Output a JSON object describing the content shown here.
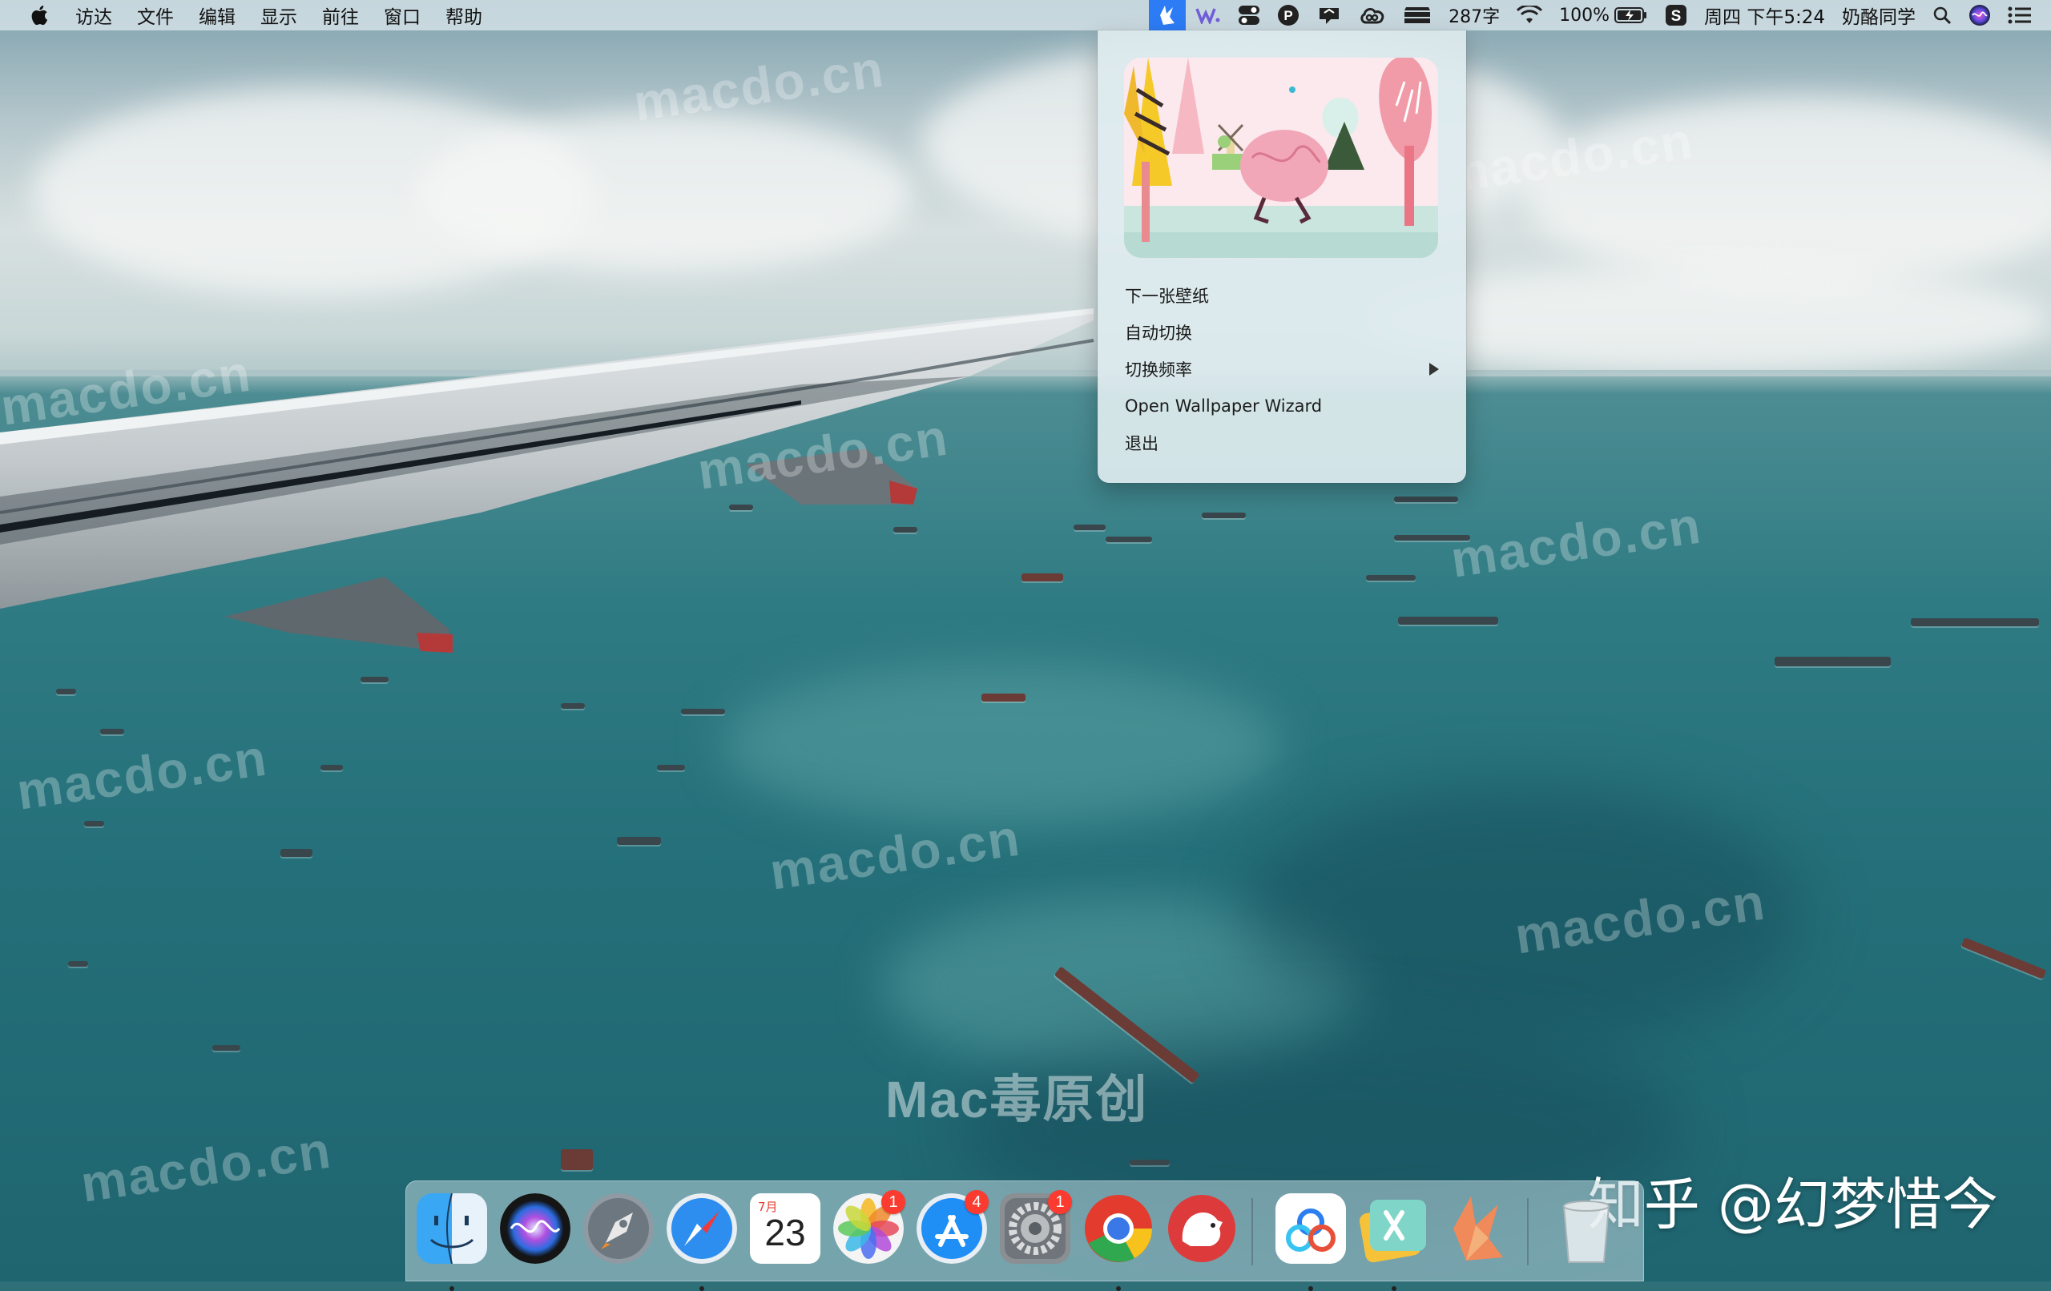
{
  "menubar": {
    "apple_icon": "apple-logo-icon",
    "menus": [
      "访达",
      "文件",
      "编辑",
      "显示",
      "前往",
      "窗口",
      "帮助"
    ],
    "status": {
      "word_count": "287字",
      "battery": "100%",
      "datetime": "周四 下午5:24",
      "user": "奶酪同学"
    }
  },
  "dropdown": {
    "items": [
      {
        "label": "下一张壁纸",
        "has_submenu": false
      },
      {
        "label": "自动切换",
        "has_submenu": false
      },
      {
        "label": "切换频率",
        "has_submenu": true
      },
      {
        "label": "Open Wallpaper Wizard",
        "has_submenu": false
      },
      {
        "label": "退出",
        "has_submenu": false
      }
    ]
  },
  "dock": {
    "apps": [
      {
        "name": "finder",
        "badge": null,
        "running": true
      },
      {
        "name": "siri",
        "badge": null,
        "running": false
      },
      {
        "name": "launchpad",
        "badge": null,
        "running": false
      },
      {
        "name": "safari",
        "badge": null,
        "running": true
      },
      {
        "name": "calendar",
        "badge": null,
        "running": false,
        "month": "7月",
        "day": "23"
      },
      {
        "name": "photos",
        "badge": "1",
        "running": false
      },
      {
        "name": "app-store",
        "badge": "4",
        "running": false
      },
      {
        "name": "system-preferences",
        "badge": "1",
        "running": false
      },
      {
        "name": "chrome",
        "badge": null,
        "running": true
      },
      {
        "name": "bear",
        "badge": null,
        "running": false
      },
      {
        "name": "baidu-netdisk",
        "badge": null,
        "running": true
      },
      {
        "name": "xmind",
        "badge": null,
        "running": true
      },
      {
        "name": "wallpaper-wizard",
        "badge": null,
        "running": false
      },
      {
        "name": "trash",
        "badge": null,
        "running": false
      }
    ]
  },
  "watermarks": {
    "site": "macdo.cn",
    "center": "Mac毒原创",
    "zhihu": "知乎 @幻梦惜今"
  },
  "colors": {
    "menu_highlight": "#2d7cf6",
    "badge": "#fb3b30",
    "sea": "#246f79"
  }
}
